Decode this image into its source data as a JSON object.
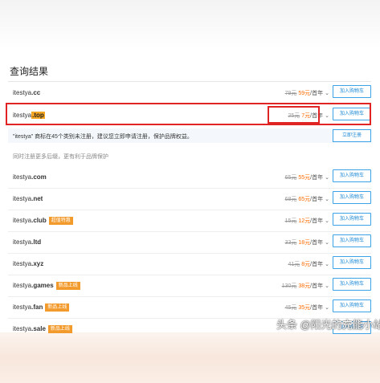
{
  "title": "查询结果",
  "main_rows": [
    {
      "prefix": "itestya",
      "tld": ".cc",
      "old": "79元",
      "new": "59元",
      "unit": "/首年",
      "button": "加入购物车"
    },
    {
      "prefix": "itestya",
      "tld": ".top",
      "old": "25元",
      "new": "7元",
      "unit": "/首年",
      "button": "加入购物车"
    }
  ],
  "notice": {
    "text": "\"itestya\" 商标在45个类别未注册，建议您立即申请注册，保护品牌权益。",
    "button": "立即注册"
  },
  "section_label": "同时注册更多后缀，更有利于品牌保护",
  "more_rows": [
    {
      "prefix": "itestya",
      "tld": ".com",
      "badge": "",
      "old": "65元",
      "new": "55元",
      "unit": "/首年",
      "button": "加入购物车"
    },
    {
      "prefix": "itestya",
      "tld": ".net",
      "badge": "",
      "old": "68元",
      "new": "65元",
      "unit": "/首年",
      "button": "加入购物车"
    },
    {
      "prefix": "itestya",
      "tld": ".club",
      "badge": "超值特惠",
      "old": "15元",
      "new": "12元",
      "unit": "/首年",
      "button": "加入购物车"
    },
    {
      "prefix": "itestya",
      "tld": ".ltd",
      "badge": "",
      "old": "33元",
      "new": "18元",
      "unit": "/首年",
      "button": "加入购物车"
    },
    {
      "prefix": "itestya",
      "tld": ".xyz",
      "badge": "",
      "old": "41元",
      "new": "8元",
      "unit": "/首年",
      "button": "加入购物车"
    },
    {
      "prefix": "itestya",
      "tld": ".games",
      "badge": "新品上线",
      "old": "130元",
      "new": "38元",
      "unit": "/首年",
      "button": "加入购物车"
    },
    {
      "prefix": "itestya",
      "tld": ".fan",
      "badge": "新品上线",
      "old": "45元",
      "new": "35元",
      "unit": "/首年",
      "button": "加入购物车"
    },
    {
      "prefix": "itestya",
      "tld": ".sale",
      "badge": "新品上线",
      "old": "",
      "new": "",
      "unit": "",
      "button": "加入购物车"
    }
  ],
  "watermark": "头条 @阳光的充能小站",
  "colors": {
    "accent": "#1d8ad6",
    "price": "#ff6a00",
    "highlight_border": "#e02424",
    "badge": "#f39a2c"
  }
}
